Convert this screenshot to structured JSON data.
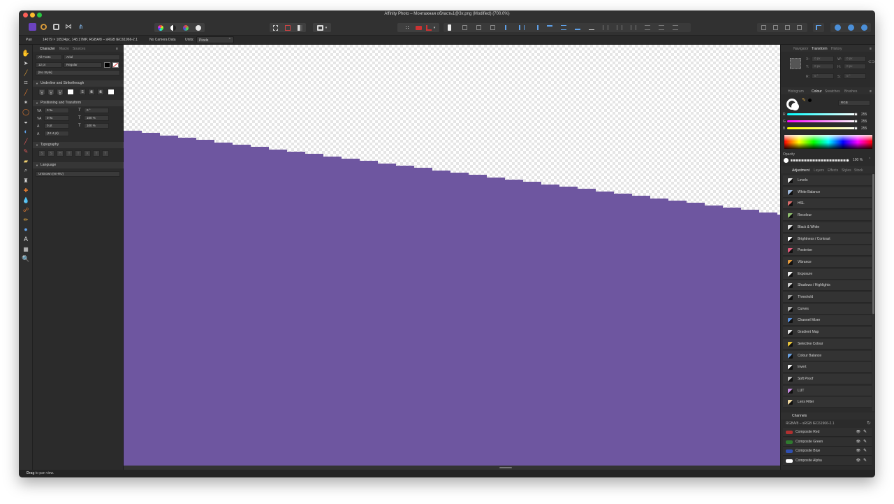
{
  "window": {
    "title": "Affinity Photo – Монтажная область1@3x.png (Modified) (700.0%)"
  },
  "context_bar": {
    "tool": "Pan",
    "doc_info": "14079 × 10524px, 148.17MP, RGBA/8 – sRGB IEC61966-2.1",
    "camera": "No Camera Data",
    "units_label": "Units:",
    "units_value": "Pixels"
  },
  "left_panel": {
    "tabs": [
      "Character",
      "Macro",
      "Sources"
    ],
    "font_collection": "All Fonts",
    "font_family": "Arial",
    "font_size": "12 pt",
    "font_style": "Regular",
    "text_style": "[No Style]",
    "sections": {
      "underline": "Underline and Strikethrough",
      "positioning": "Positioning and Transform",
      "typography": "Typography",
      "language": "Language"
    },
    "underline_buttons": [
      "U",
      "U",
      "U",
      "",
      "S",
      "S",
      "S",
      ""
    ],
    "positioning_fields": {
      "tracking": "0 ‰",
      "shear": "0 °",
      "kerning": "0 ‰",
      "vertical_scale": "100 %",
      "baseline": "0 pt",
      "horizontal_scale": "100 %",
      "leading": "(12.4 pt)"
    },
    "language_value": "Unknown (en-RU)"
  },
  "right_panel": {
    "top_tabs": [
      "Navigator",
      "Transform",
      "History"
    ],
    "transform": {
      "x": "0 px",
      "y": "0 px",
      "w": "0 px",
      "h": "0 px",
      "r": "0 °",
      "s": "0 °"
    },
    "colour_tabs": [
      "Histogram",
      "Colour",
      "Swatches",
      "Brushes"
    ],
    "colour_model": "RGB",
    "rgb": {
      "r": "255",
      "g": "255",
      "b": "255"
    },
    "opacity_label": "Opacity",
    "opacity_value": "100 %",
    "adjust_tabs": [
      "Adjustment",
      "Layers",
      "Effects",
      "Styles",
      "Stock"
    ],
    "adjustments": [
      {
        "label": "Levels",
        "icon": "levels-icon",
        "color": "#e8e8e8"
      },
      {
        "label": "White Balance",
        "icon": "white-balance-icon",
        "color": "#9fb7d8"
      },
      {
        "label": "HSL",
        "icon": "hsl-icon",
        "color": "#d86b6b"
      },
      {
        "label": "Recolour",
        "icon": "recolour-icon",
        "color": "#8fbf6f"
      },
      {
        "label": "Black & White",
        "icon": "black-white-icon",
        "color": "#dddddd"
      },
      {
        "label": "Brightness / Contrast",
        "icon": "brightness-contrast-icon",
        "color": "#ffffff"
      },
      {
        "label": "Posterise",
        "icon": "posterise-icon",
        "color": "#e05a7a"
      },
      {
        "label": "Vibrance",
        "icon": "vibrance-icon",
        "color": "#e39a3c"
      },
      {
        "label": "Exposure",
        "icon": "exposure-icon",
        "color": "#f0f0f0"
      },
      {
        "label": "Shadows / Highlights",
        "icon": "shadows-highlights-icon",
        "color": "#cfcfcf"
      },
      {
        "label": "Threshold",
        "icon": "threshold-icon",
        "color": "#a0a0a0"
      },
      {
        "label": "Curves",
        "icon": "curves-icon",
        "color": "#b0b0b0"
      },
      {
        "label": "Channel Mixer",
        "icon": "channel-mixer-icon",
        "color": "#5a8fd8"
      },
      {
        "label": "Gradient Map",
        "icon": "gradient-map-icon",
        "color": "#e0e0e0"
      },
      {
        "label": "Selective Colour",
        "icon": "selective-colour-icon",
        "color": "#e8c43a"
      },
      {
        "label": "Colour Balance",
        "icon": "colour-balance-icon",
        "color": "#6aa0e0"
      },
      {
        "label": "Invert",
        "icon": "invert-icon",
        "color": "#f5f5f5"
      },
      {
        "label": "Soft Proof",
        "icon": "soft-proof-icon",
        "color": "#c0c0c0"
      },
      {
        "label": "LUT",
        "icon": "lut-icon",
        "color": "#c78be0"
      },
      {
        "label": "Lens Filter",
        "icon": "lens-filter-icon",
        "color": "#f0d8a0"
      }
    ],
    "channels_title": "Channels",
    "channels_profile": "RGBA/8 – sRGB IEC61966-2.1",
    "channels": [
      {
        "label": "Composite Red",
        "color": "#b03030"
      },
      {
        "label": "Composite Green",
        "color": "#2f7a2f"
      },
      {
        "label": "Composite Blue",
        "color": "#2f4fb0"
      },
      {
        "label": "Composite Alpha",
        "color": "#ffffff"
      }
    ]
  },
  "canvas": {
    "fill_color": "#6e56a0"
  },
  "status": {
    "bold": "Drag",
    "text": " to pan view."
  }
}
